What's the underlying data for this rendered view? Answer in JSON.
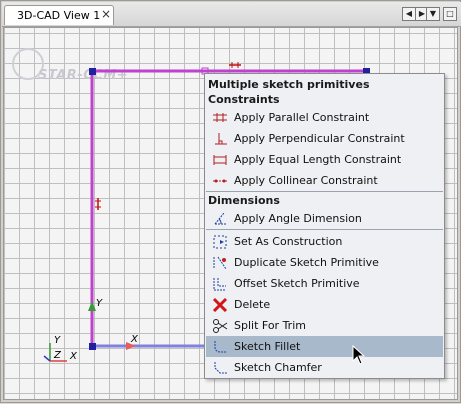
{
  "tab": {
    "title": "3D-CAD View 1",
    "close": "×"
  },
  "nav": {
    "prev": "◀",
    "next": "▶",
    "menu": "▼",
    "maximize": "□"
  },
  "logo_text": "STAR-CCM+",
  "axes": {
    "x": "X",
    "y": "Y",
    "z": "Z",
    "sketch_x": "X",
    "sketch_y": "Y"
  },
  "colors": {
    "sketch_line": "#c040d0",
    "selected_line": "#8080e0",
    "point": "#2020a0",
    "menu_bg": "#eef0f4",
    "selected": "#a9b9cc"
  },
  "menu": {
    "header1": "Multiple sketch primitives",
    "header2": "Constraints",
    "constraints": [
      {
        "label": "Apply Parallel Constraint",
        "icon": "parallel-constraint-icon"
      },
      {
        "label": "Apply Perpendicular Constraint",
        "icon": "perpendicular-constraint-icon"
      },
      {
        "label": "Apply Equal Length Constraint",
        "icon": "equal-length-constraint-icon"
      },
      {
        "label": "Apply Collinear Constraint",
        "icon": "collinear-constraint-icon"
      }
    ],
    "header3": "Dimensions",
    "dimensions": [
      {
        "label": "Apply Angle Dimension",
        "icon": "angle-dimension-icon"
      }
    ],
    "actions": [
      {
        "label": "Set As Construction",
        "icon": "construction-icon"
      },
      {
        "label": "Duplicate Sketch Primitive",
        "icon": "duplicate-icon"
      },
      {
        "label": "Offset Sketch Primitive",
        "icon": "offset-icon"
      },
      {
        "label": "Delete",
        "icon": "delete-icon"
      },
      {
        "label": "Split For Trim",
        "icon": "scissors-icon"
      },
      {
        "label": "Sketch Fillet",
        "icon": "fillet-icon"
      },
      {
        "label": "Sketch Chamfer",
        "icon": "chamfer-icon"
      }
    ],
    "selected_item": "Sketch Fillet"
  }
}
